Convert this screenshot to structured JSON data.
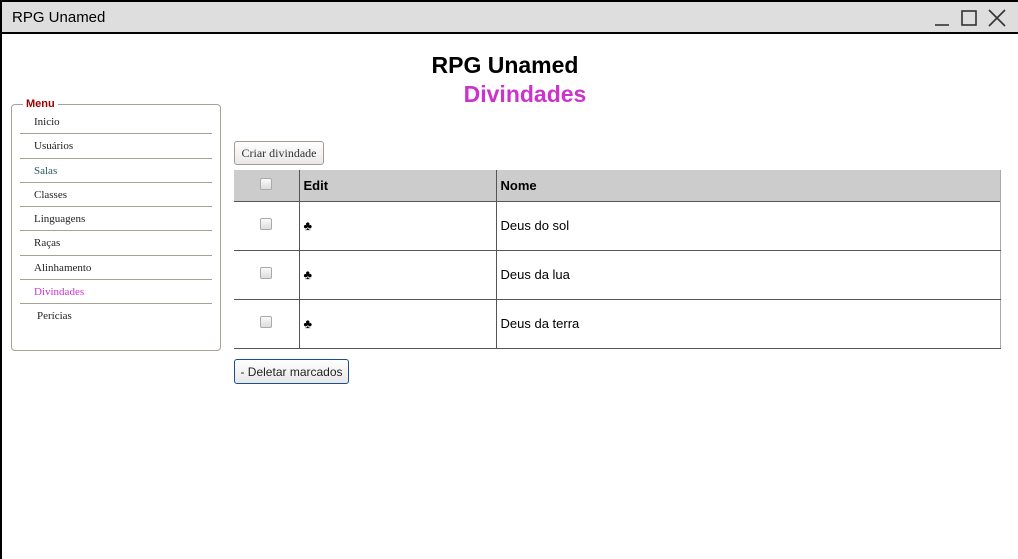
{
  "window": {
    "title": "RPG Unamed"
  },
  "page": {
    "title": "RPG Unamed",
    "subtitle": "Divindades"
  },
  "menu": {
    "legend": "Menu",
    "items": [
      "Inicio",
      "Usuários",
      "Salas",
      "Classes",
      "Linguagens",
      "Raças",
      "Alinhamento",
      "Divindades",
      "Perícias"
    ],
    "active": "Divindades"
  },
  "buttons": {
    "create": "Criar divindade",
    "delete": "- Deletar marcados"
  },
  "table": {
    "headers": [
      "Edit",
      "Nome"
    ],
    "edit_icon": "♣",
    "rows": [
      {
        "nome": "Deus do sol",
        "checked": false
      },
      {
        "nome": "Deus da lua",
        "checked": false
      },
      {
        "nome": "Deus da terra",
        "checked": false
      }
    ]
  },
  "colors": {
    "accent": "#cc33cc",
    "legend": "#990000"
  }
}
